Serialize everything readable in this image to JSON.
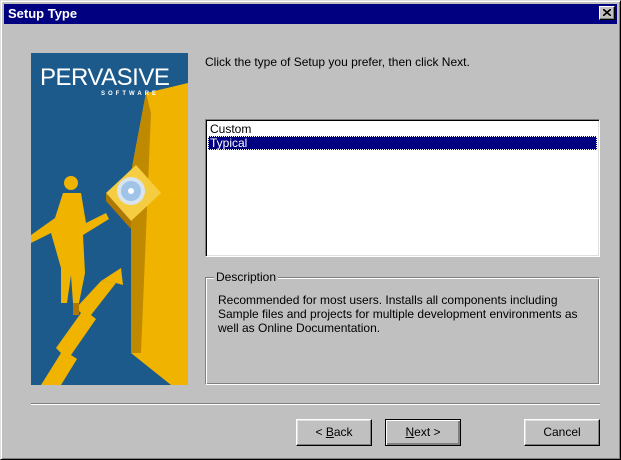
{
  "window": {
    "title": "Setup Type",
    "close_icon": "close-icon"
  },
  "banner": {
    "logo_text": "PERVASIVE",
    "logo_subtext": "SOFTWARE",
    "colors": {
      "background": "#1d5a8c",
      "figure": "#f0b400",
      "shadow": "#b07800"
    }
  },
  "instruction": "Click the type of Setup you prefer, then click Next.",
  "setup_types": {
    "items": [
      {
        "label": "Custom",
        "selected": false
      },
      {
        "label": "Typical",
        "selected": true
      }
    ]
  },
  "description": {
    "label": "Description",
    "text": "Recommended for most users. Installs all components including Sample files and projects for multiple development environments as well as Online Documentation."
  },
  "buttons": {
    "back": {
      "prefix": "< ",
      "accel": "B",
      "rest": "ack"
    },
    "next": {
      "accel": "N",
      "rest": "ext >"
    },
    "cancel": "Cancel"
  }
}
